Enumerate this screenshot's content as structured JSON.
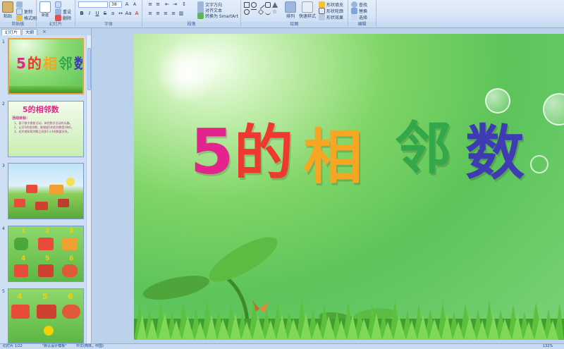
{
  "ribbon": {
    "clipboard": {
      "paste": "粘贴",
      "copy": "复制",
      "format": "格式刷",
      "label": "剪贴板"
    },
    "slides": {
      "new_slide": "新建\n幻灯片",
      "reset": "重设",
      "delete": "删除",
      "label": "幻灯片"
    },
    "font": {
      "name": "",
      "size": "38",
      "label": "字体"
    },
    "paragraph": {
      "label": "段落",
      "text_dir": "文字方向",
      "align_text": "对齐文本",
      "smartart": "转换为 SmartArt"
    },
    "drawing": {
      "arrange": "排列",
      "quick_styles": "快速样式",
      "shape_fill": "形状填充",
      "shape_outline": "形状轮廓",
      "shape_effects": "形状效果",
      "label": "绘图"
    },
    "editing": {
      "find": "查找",
      "replace": "替换",
      "select": "选择",
      "label": "编辑"
    }
  },
  "left_pane": {
    "tabs": [
      "幻灯片",
      "大纲"
    ],
    "close": "×",
    "thumbnails": [
      {
        "num": "1",
        "title": "5的相邻数"
      },
      {
        "num": "2",
        "title": "5的相邻数",
        "heading": "活动目标：",
        "lines": [
          "1、基于数字素能活动，体验数学活动的乐趣。",
          "2、认识5的相邻数，能根据5的相邻数是4和6。",
          "3、初步感知相邻数之间多1少1的数量关系。"
        ]
      },
      {
        "num": "3"
      },
      {
        "num": "4",
        "digits": [
          "1",
          "2",
          "3",
          "4",
          "5",
          "6"
        ]
      },
      {
        "num": "5",
        "digits": [
          "4",
          "5",
          "6"
        ]
      }
    ]
  },
  "slide": {
    "title_chars": [
      "5",
      "的",
      "相",
      "邻",
      "数"
    ],
    "title_colors": [
      "#e3248d",
      "#ee3a2e",
      "#f5a623",
      "#32a84a",
      "#3f3bb2"
    ]
  },
  "status": {
    "slide_index": "幻灯片 1/22",
    "theme": "\"默认设计模板\"",
    "language": "中文(简体，中国)",
    "zoom": "132%"
  }
}
